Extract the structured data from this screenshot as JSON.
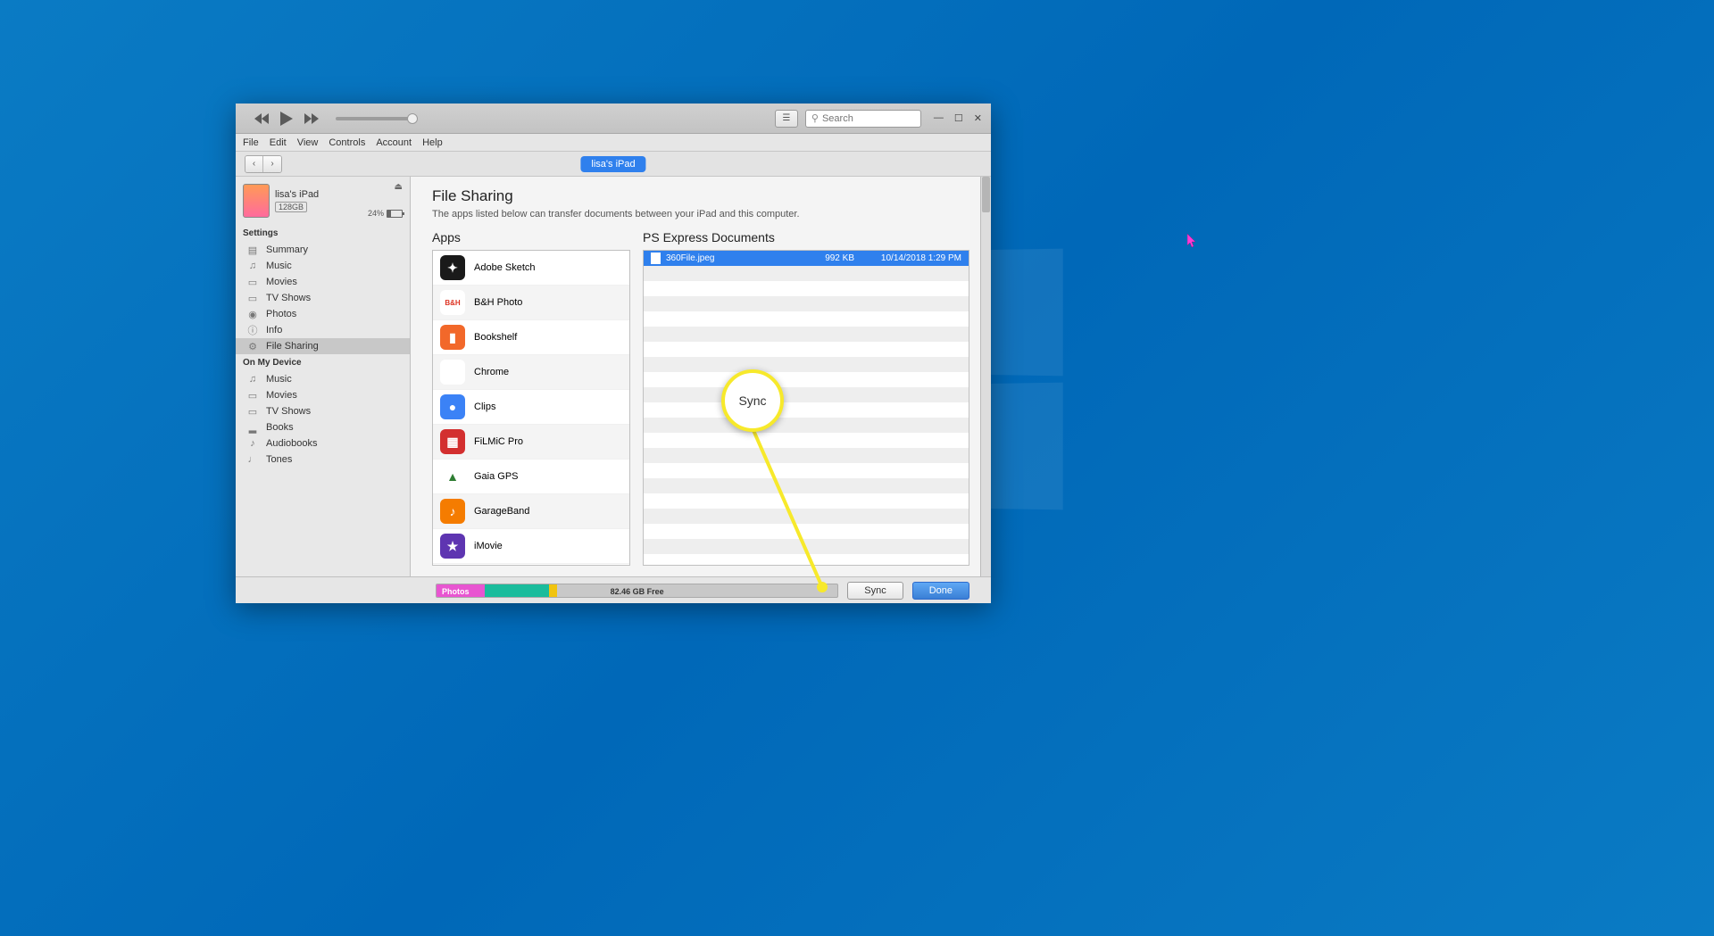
{
  "menubar": {
    "file": "File",
    "edit": "Edit",
    "view": "View",
    "controls": "Controls",
    "account": "Account",
    "help": "Help"
  },
  "search": {
    "placeholder": "Search"
  },
  "device": {
    "name": "lisa's iPad",
    "capacity": "128GB",
    "battery": "24%",
    "pill": "lisa's iPad"
  },
  "sidebar": {
    "settings_header": "Settings",
    "settings": [
      {
        "label": "Summary"
      },
      {
        "label": "Music"
      },
      {
        "label": "Movies"
      },
      {
        "label": "TV Shows"
      },
      {
        "label": "Photos"
      },
      {
        "label": "Info"
      },
      {
        "label": "File Sharing"
      }
    ],
    "ondevice_header": "On My Device",
    "ondevice": [
      {
        "label": "Music"
      },
      {
        "label": "Movies"
      },
      {
        "label": "TV Shows"
      },
      {
        "label": "Books"
      },
      {
        "label": "Audiobooks"
      },
      {
        "label": "Tones"
      }
    ]
  },
  "main": {
    "title": "File Sharing",
    "subtitle": "The apps listed below can transfer documents between your iPad and this computer.",
    "apps_header": "Apps",
    "docs_header": "PS Express Documents",
    "apps": [
      {
        "name": "Adobe Sketch",
        "bg": "#1a1a1a",
        "glyph": "✦"
      },
      {
        "name": "B&H Photo",
        "bg": "#fff",
        "fg": "#d32",
        "glyph": "B&H"
      },
      {
        "name": "Bookshelf",
        "bg": "#f2682a",
        "glyph": "▮"
      },
      {
        "name": "Chrome",
        "bg": "#fff",
        "glyph": "◉"
      },
      {
        "name": "Clips",
        "bg": "#3b82f6",
        "glyph": "●"
      },
      {
        "name": "FiLMiC Pro",
        "bg": "#d32f2f",
        "glyph": "▦"
      },
      {
        "name": "Gaia GPS",
        "bg": "#fff",
        "fg": "#2e7d32",
        "glyph": "▲"
      },
      {
        "name": "GarageBand",
        "bg": "#f57c00",
        "glyph": "♪"
      },
      {
        "name": "iMovie",
        "bg": "#5e35b1",
        "glyph": "★"
      }
    ],
    "files": [
      {
        "name": "360File.jpeg",
        "size": "992 KB",
        "date": "10/14/2018 1:29 PM"
      }
    ]
  },
  "footer": {
    "photos_label": "Photos",
    "free_label": "82.46 GB Free",
    "sync": "Sync",
    "done": "Done"
  },
  "annotation": {
    "label": "Sync"
  }
}
